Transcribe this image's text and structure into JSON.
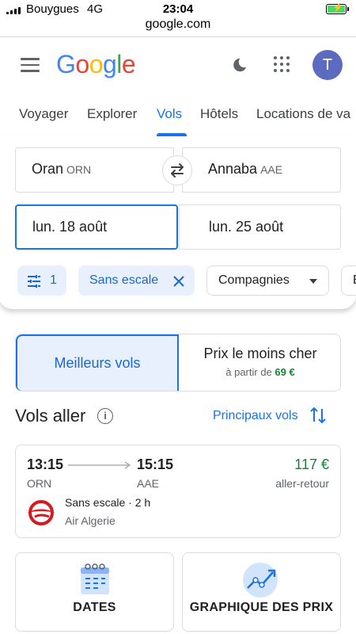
{
  "status_bar": {
    "carrier": "Bouygues",
    "network": "4G",
    "time": "23:04",
    "url": "google.com"
  },
  "header": {
    "logo_letters": [
      {
        "ch": "G",
        "color": "#4285f4"
      },
      {
        "ch": "o",
        "color": "#ea4335"
      },
      {
        "ch": "o",
        "color": "#fbbc05"
      },
      {
        "ch": "g",
        "color": "#4285f4"
      },
      {
        "ch": "l",
        "color": "#34a853"
      },
      {
        "ch": "e",
        "color": "#ea4335"
      }
    ],
    "avatar_initial": "T"
  },
  "tabs": [
    {
      "label": "Voyager"
    },
    {
      "label": "Explorer"
    },
    {
      "label": "Vols",
      "active": true
    },
    {
      "label": "Hôtels"
    },
    {
      "label": "Locations de va"
    }
  ],
  "search": {
    "origin": {
      "city": "Oran",
      "code": "ORN"
    },
    "destination": {
      "city": "Annaba",
      "code": "AAE"
    },
    "depart_date": "lun. 18 août",
    "return_date": "lun. 25 août"
  },
  "filters": {
    "count": "1",
    "stops_chip": "Sans escale",
    "airlines_chip": "Compagnies",
    "next_chip_partial": "E"
  },
  "sort_toggle": {
    "best_label": "Meilleurs vols",
    "cheapest_label": "Prix le moins cher",
    "cheapest_prefix": "à partir de",
    "cheapest_price": "69 €"
  },
  "results": {
    "title": "Vols aller",
    "sort_label": "Principaux vols"
  },
  "flight": {
    "depart_time": "13:15",
    "arrive_time": "15:15",
    "origin_code": "ORN",
    "dest_code": "AAE",
    "price": "117 €",
    "price_type": "aller-retour",
    "stops": "Sans escale",
    "separator": "·",
    "duration": "2 h",
    "airline": "Air Algerie"
  },
  "tiles": {
    "dates_label": "DATES",
    "graph_label": "GRAPHIQUE DES PRIX"
  },
  "colors": {
    "accent": "#1a73e8",
    "price_green": "#188038",
    "airline_red": "#d71920"
  }
}
